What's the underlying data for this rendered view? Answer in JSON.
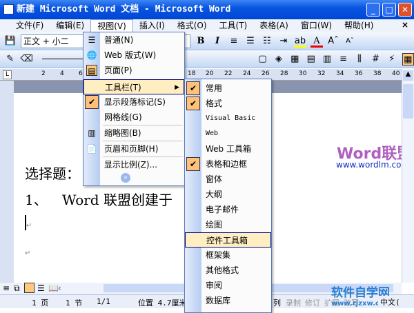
{
  "window": {
    "title": "新建 Microsoft Word 文档 - Microsoft Word",
    "minimize": "_",
    "maximize": "□",
    "close": "✕"
  },
  "menubar": [
    "文件(F)",
    "编辑(E)",
    "视图(V)",
    "插入(I)",
    "格式(O)",
    "工具(T)",
    "表格(A)",
    "窗口(W)",
    "帮助(H)"
  ],
  "menubar_close": "×",
  "toolbar": {
    "style": "正文 + 小二",
    "size": "小二",
    "bold": "B",
    "italic": "I"
  },
  "ruler": [
    "2",
    "4",
    "6",
    "18",
    "20",
    "22",
    "24",
    "26",
    "28",
    "30",
    "32",
    "34",
    "36",
    "38",
    "40"
  ],
  "view_menu": [
    {
      "label": "普通(N)",
      "icon": "normal-view-icon"
    },
    {
      "label": "Web 版式(W)",
      "icon": "web-layout-icon"
    },
    {
      "label": "页面(P)",
      "icon": "page-layout-icon"
    },
    {
      "label": "工具栏(T)",
      "arrow": "▶"
    },
    {
      "label": "显示段落标记(S)",
      "checked": true
    },
    {
      "label": "网格线(G)"
    },
    {
      "label": "缩略图(B)",
      "icon": "thumbnail-icon"
    },
    {
      "label": "页眉和页脚(H)",
      "icon": "header-footer-icon"
    },
    {
      "label": "显示比例(Z)..."
    }
  ],
  "toolbars_submenu": [
    {
      "label": "常用",
      "checked": true
    },
    {
      "label": "格式",
      "checked": true
    },
    {
      "label": "Visual Basic"
    },
    {
      "label": "Web"
    },
    {
      "label": "Web 工具箱"
    },
    {
      "label": "表格和边框",
      "checked": true
    },
    {
      "label": "窗体"
    },
    {
      "label": "大纲"
    },
    {
      "label": "电子邮件"
    },
    {
      "label": "绘图"
    },
    {
      "label": "控件工具箱",
      "highlighted": true
    },
    {
      "label": "框架集"
    },
    {
      "label": "其他格式"
    },
    {
      "label": "审阅"
    },
    {
      "label": "数据库"
    }
  ],
  "document": {
    "line1": "选择题：",
    "line2_num": "1、",
    "line2_text": "Word 联盟创建于",
    "pilcrow": "↵"
  },
  "watermark": {
    "brand": "Word联盟",
    "url": "www.wordlm.com"
  },
  "logo": {
    "name": "软件自学网",
    "url": "www.rjzxw.com"
  },
  "status": [
    "1 页",
    "1 节",
    "1/1",
    "位置 4.7厘米",
    "列",
    "录制",
    "修订",
    "扩展",
    "改写",
    "中文("
  ]
}
